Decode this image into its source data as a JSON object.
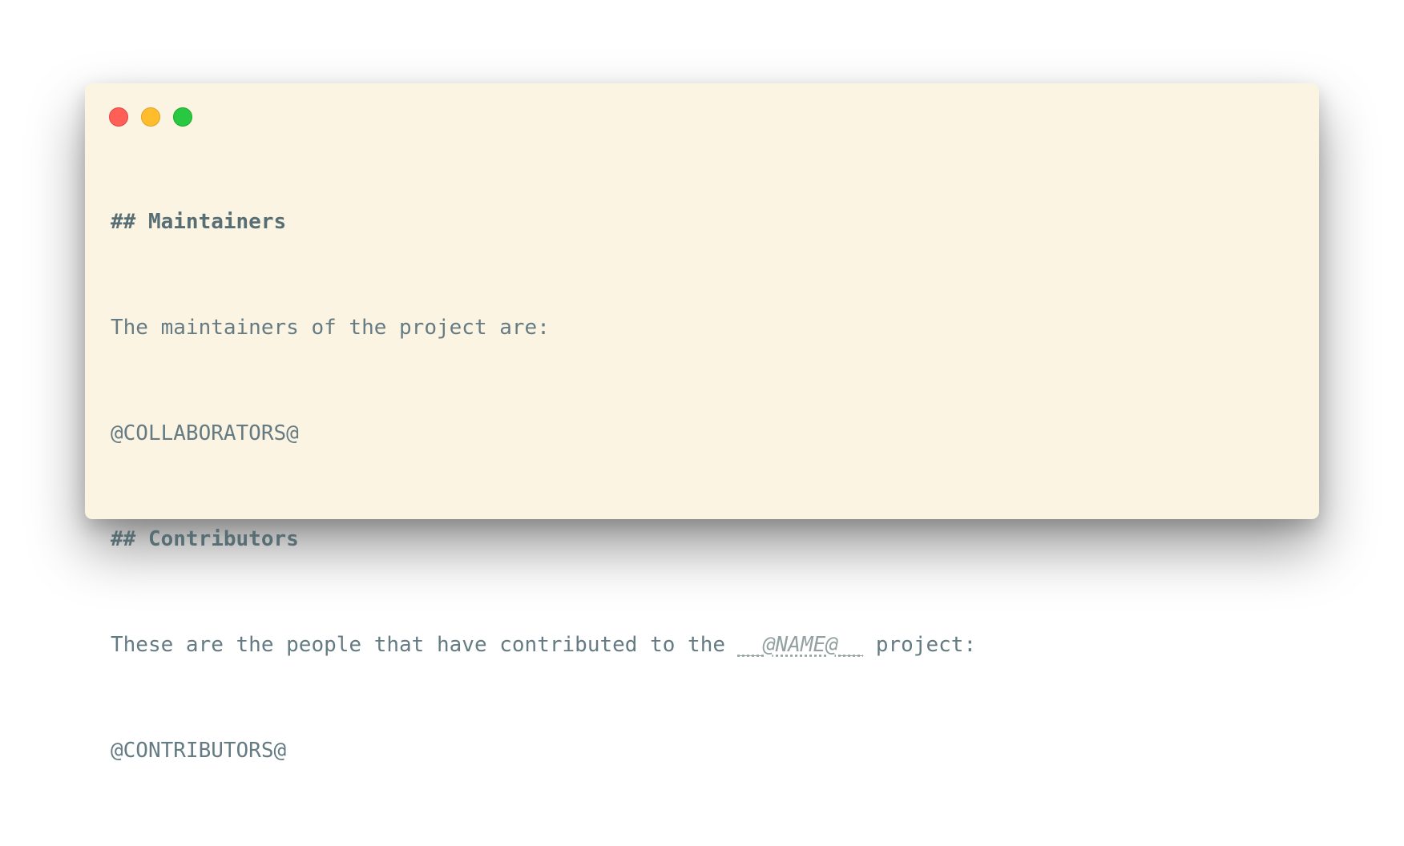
{
  "window": {
    "controls": {
      "close": "close",
      "minimize": "minimize",
      "maximize": "maximize"
    }
  },
  "content": {
    "lines": [
      {
        "text": "## Maintainers"
      },
      {
        "text": "The maintainers of the project are:"
      },
      {
        "text": "@COLLABORATORS@"
      },
      {
        "text": "## Contributors"
      },
      {
        "prefix": "These are the people that have contributed to the ",
        "var": "__@NAME@__",
        "suffix": " project:"
      },
      {
        "text": "@CONTRIBUTORS@"
      }
    ]
  },
  "colors": {
    "background": "#fcf4e2",
    "text": "#657b83",
    "heading": "#586e75",
    "var": "#93a1a1",
    "close": "#ff5f57",
    "minimize": "#ffbd2e",
    "maximize": "#28c840"
  }
}
